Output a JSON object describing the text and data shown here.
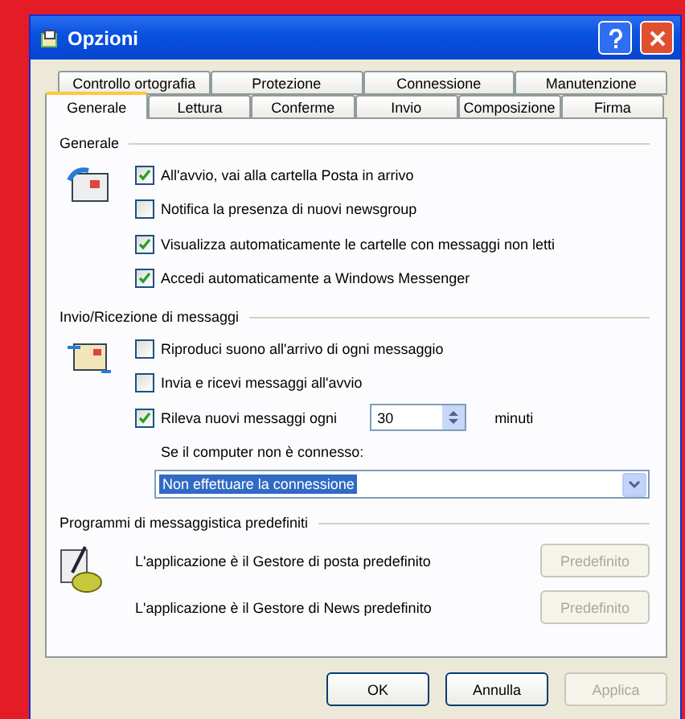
{
  "window": {
    "title": "Opzioni"
  },
  "tab_rows": [
    [
      {
        "label": "Controllo ortografia",
        "selected": false
      },
      {
        "label": "Protezione",
        "selected": false
      },
      {
        "label": "Connessione",
        "selected": false
      },
      {
        "label": "Manutenzione",
        "selected": false
      }
    ],
    [
      {
        "label": "Generale",
        "selected": true
      },
      {
        "label": "Lettura",
        "selected": false
      },
      {
        "label": "Conferme",
        "selected": false
      },
      {
        "label": "Invio",
        "selected": false
      },
      {
        "label": "Composizione",
        "selected": false
      },
      {
        "label": "Firma",
        "selected": false
      }
    ]
  ],
  "general": {
    "title": "Generale",
    "options": [
      {
        "label": "All'avvio, vai alla cartella Posta in arrivo",
        "checked": true
      },
      {
        "label": "Notifica la presenza di nuovi newsgroup",
        "checked": false
      },
      {
        "label": "Visualizza automaticamente le cartelle con messaggi non letti",
        "checked": true
      },
      {
        "label": "Accedi automaticamente a Windows Messenger",
        "checked": true
      }
    ]
  },
  "send_receive": {
    "title": "Invio/Ricezione di messaggi",
    "options": [
      {
        "label": "Riproduci suono all'arrivo di ogni messaggio",
        "checked": false
      },
      {
        "label": "Invia e ricevi messaggi all'avvio",
        "checked": false
      }
    ],
    "interval": {
      "label": "Rileva nuovi messaggi ogni",
      "checked": true,
      "value": "30",
      "unit": "minuti"
    },
    "connection_label": "Se il computer non è connesso:",
    "connection_value": "Non effettuare la connessione"
  },
  "defaults": {
    "title": "Programmi di messaggistica predefiniti",
    "rows": [
      {
        "text": "L'applicazione è il Gestore di posta predefinito",
        "button": "Predefinito",
        "disabled": true
      },
      {
        "text": "L'applicazione è il Gestore di News predefinito",
        "button": "Predefinito",
        "disabled": true
      }
    ]
  },
  "buttons": [
    {
      "label": "OK",
      "disabled": false
    },
    {
      "label": "Annulla",
      "disabled": false
    },
    {
      "label": "Applica",
      "disabled": true
    }
  ]
}
